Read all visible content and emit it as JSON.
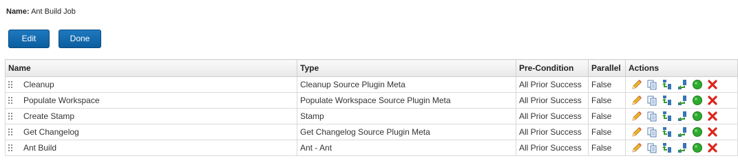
{
  "job": {
    "name_label": "Name:",
    "name_value": "Ant Build Job"
  },
  "buttons": {
    "edit": "Edit",
    "done": "Done"
  },
  "table": {
    "headers": {
      "name": "Name",
      "type": "Type",
      "precondition": "Pre-Condition",
      "parallel": "Parallel",
      "actions": "Actions"
    },
    "rows": [
      {
        "name": "Cleanup",
        "type": "Cleanup Source Plugin Meta",
        "precondition": "All Prior Success",
        "parallel": "False"
      },
      {
        "name": "Populate Workspace",
        "type": "Populate Workspace Source Plugin Meta",
        "precondition": "All Prior Success",
        "parallel": "False"
      },
      {
        "name": "Create Stamp",
        "type": "Stamp",
        "precondition": "All Prior Success",
        "parallel": "False"
      },
      {
        "name": "Get Changelog",
        "type": "Get Changelog Source Plugin Meta",
        "precondition": "All Prior Success",
        "parallel": "False"
      },
      {
        "name": "Ant Build",
        "type": "Ant - Ant",
        "precondition": "All Prior Success",
        "parallel": "False"
      }
    ]
  },
  "icons": {
    "drag": "drag-handle-icon",
    "edit": "pencil-icon",
    "copy": "copy-icon",
    "move_up": "move-up-icon",
    "move_down": "move-down-icon",
    "enable": "green-circle-icon",
    "delete": "red-x-icon"
  },
  "colors": {
    "button_blue": "#1570b5",
    "active_green": "#2eaa2e",
    "delete_red": "#d9261c"
  }
}
